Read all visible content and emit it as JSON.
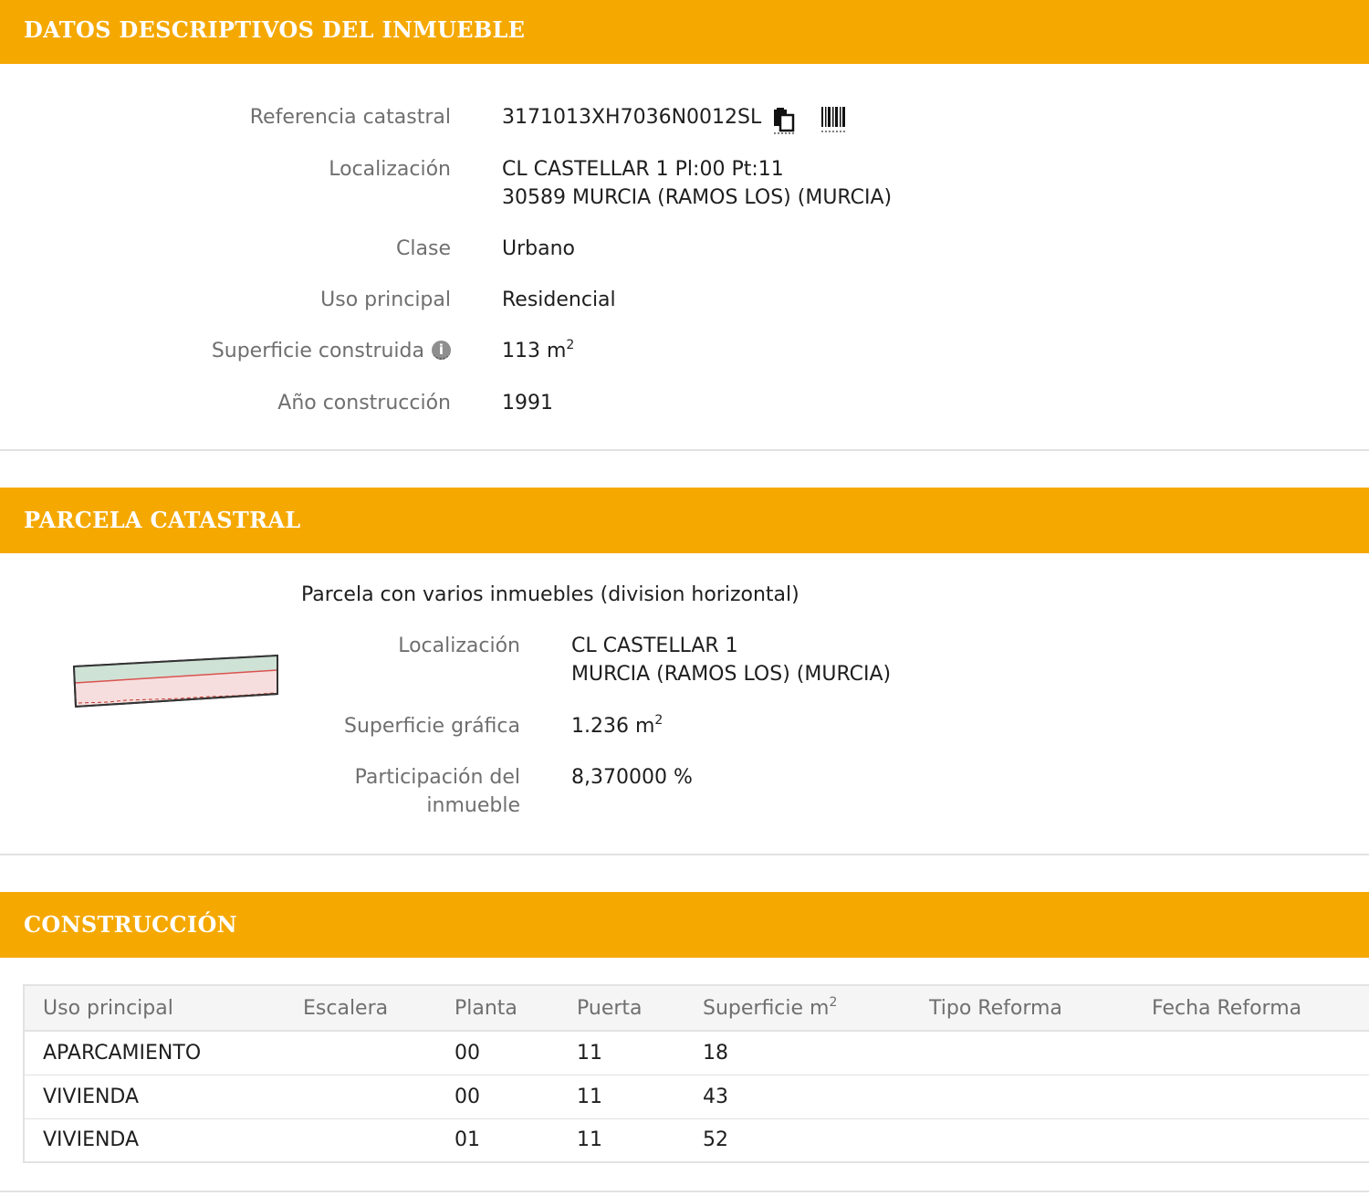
{
  "section1": {
    "title": "DATOS DESCRIPTIVOS DEL INMUEBLE",
    "ref_label": "Referencia catastral",
    "ref_value": "3171013XH7036N0012SL",
    "loc_label": "Localización",
    "loc_line1": "CL CASTELLAR 1 Pl:00 Pt:11",
    "loc_line2": "30589 MURCIA (RAMOS LOS) (MURCIA)",
    "clase_label": "Clase",
    "clase_value": "Urbano",
    "uso_label": "Uso principal",
    "uso_value": "Residencial",
    "sup_label": "Superficie construida",
    "sup_value": "113 m",
    "sup_unit_exp": "2",
    "anio_label": "Año construcción",
    "anio_value": "1991",
    "icons": [
      "copy-icon",
      "barcode-icon",
      "info-icon"
    ]
  },
  "section2": {
    "title": "PARCELA CATASTRAL",
    "description": "Parcela con varios inmuebles (division horizontal)",
    "loc_label": "Localización",
    "loc_line1": "CL CASTELLAR 1",
    "loc_line2": "MURCIA (RAMOS LOS) (MURCIA)",
    "sup_label": "Superficie gráfica",
    "sup_value": "1.236 m",
    "sup_unit_exp": "2",
    "part_label_line1": "Participación del",
    "part_label_line2": "inmueble",
    "part_value": "8,370000 %",
    "colors": {
      "parcel_fill": "#f7dede",
      "parcel_green": "#cfe2d6",
      "parcel_line": "#d9534f"
    }
  },
  "section3": {
    "title": "CONSTRUCCIÓN",
    "headers": {
      "uso": "Uso principal",
      "escalera": "Escalera",
      "planta": "Planta",
      "puerta": "Puerta",
      "superficie": "Superficie m",
      "superficie_exp": "2",
      "tipo_reforma": "Tipo Reforma",
      "fecha_reforma": "Fecha Reforma"
    },
    "rows": [
      {
        "uso": "APARCAMIENTO",
        "escalera": "",
        "planta": "00",
        "puerta": "11",
        "superficie": "18",
        "tipo_reforma": "",
        "fecha_reforma": ""
      },
      {
        "uso": "VIVIENDA",
        "escalera": "",
        "planta": "00",
        "puerta": "11",
        "superficie": "43",
        "tipo_reforma": "",
        "fecha_reforma": ""
      },
      {
        "uso": "VIVIENDA",
        "escalera": "",
        "planta": "01",
        "puerta": "11",
        "superficie": "52",
        "tipo_reforma": "",
        "fecha_reforma": ""
      }
    ]
  },
  "colors": {
    "header_bg": "#f5a800",
    "label": "#6f6f6f",
    "border": "#e2e2e2"
  }
}
